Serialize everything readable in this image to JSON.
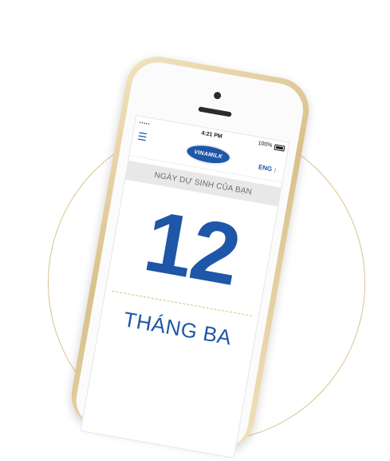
{
  "status_bar": {
    "signal": "•••••",
    "time": "4:21 PM",
    "battery": "100%"
  },
  "header": {
    "menu_icon": "hamburger-menu-icon",
    "logo_text": "VINAMILK",
    "language": "ENG",
    "language_more": "⋮"
  },
  "due_date": {
    "label": "NGÀY DỰ SINH CỦA BẠN",
    "day": "12",
    "month": "THÁNG BA"
  },
  "colors": {
    "brand_blue": "#1e56a8",
    "gold_ring": "#d8c48e",
    "label_bar": "#e8e8e8"
  }
}
